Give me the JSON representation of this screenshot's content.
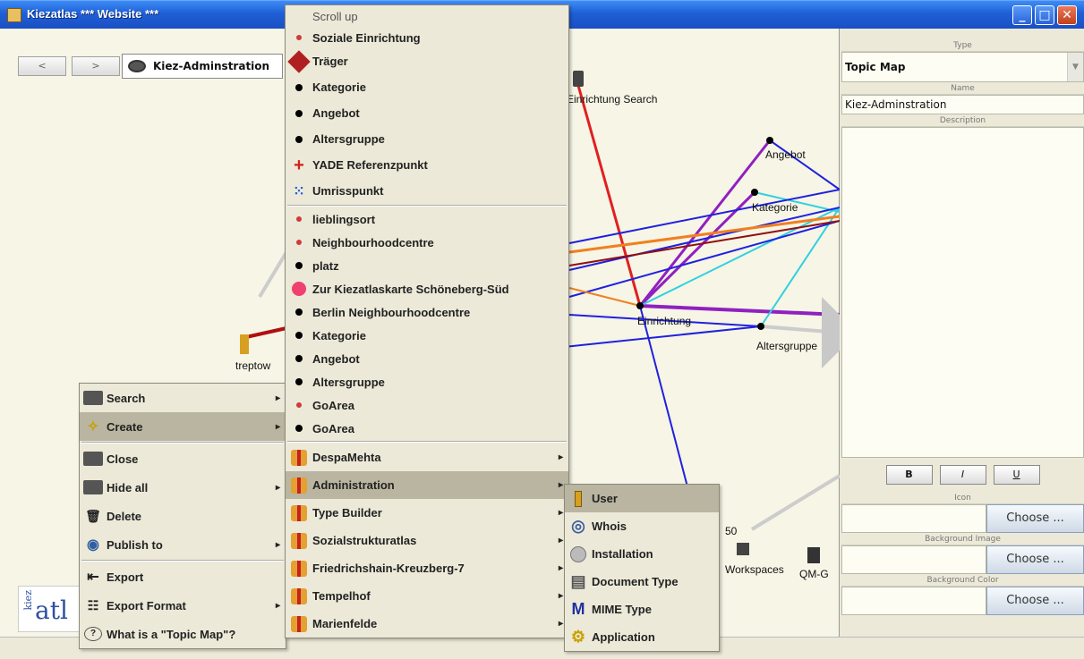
{
  "window": {
    "title": "Kiezatlas *** Website ***"
  },
  "nav": {
    "back": "<",
    "forward": ">",
    "topicmap_label": "Kiez-Adminstration"
  },
  "canvas": {
    "labels": [
      "Einrichtung Search",
      "Angebot",
      "Kategorie",
      "Einrichtung",
      "Altersgruppe",
      "treptow",
      "Workspaces",
      "QM-G",
      "50"
    ]
  },
  "panel": {
    "type_header": "Type",
    "type_value": "Topic Map",
    "name_header": "Name",
    "name_value": "Kiez-Adminstration",
    "description_header": "Description",
    "bold": "B",
    "italic": "I",
    "underline": "U",
    "icon_header": "Icon",
    "bgimage_header": "Background Image",
    "bgcolor_header": "Background Color",
    "choose": "Choose ..."
  },
  "context_menu": [
    {
      "label": "Search",
      "icon": "binoculars-icon",
      "submenu": true
    },
    {
      "label": "Create",
      "icon": "magic-wand-icon",
      "submenu": true,
      "selected": true
    },
    {
      "label": "Close",
      "icon": "close-icon",
      "submenu": false
    },
    {
      "label": "Hide all",
      "icon": "hide-icon",
      "submenu": true
    },
    {
      "label": "Delete",
      "icon": "trash-icon",
      "submenu": false
    },
    {
      "label": "Publish to",
      "icon": "publish-icon",
      "submenu": true
    },
    {
      "label": "Export",
      "icon": "export-icon",
      "submenu": false
    },
    {
      "label": "Export Format",
      "icon": "format-icon",
      "submenu": true
    },
    {
      "label": "What is a \"Topic Map\"?",
      "icon": "help-icon",
      "submenu": false
    }
  ],
  "create_menu": {
    "scroll_up": "Scroll up",
    "types_a": [
      {
        "label": "Soziale Einrichtung",
        "icon": "red-dot-icon"
      },
      {
        "label": "Träger",
        "icon": "diamond-icon"
      },
      {
        "label": "Kategorie",
        "icon": "dot-icon"
      },
      {
        "label": "Angebot",
        "icon": "dot-icon"
      },
      {
        "label": "Altersgruppe",
        "icon": "dot-icon"
      },
      {
        "label": "YADE Referenzpunkt",
        "icon": "crosshair-icon"
      },
      {
        "label": "Umrisspunkt",
        "icon": "blue-points-icon"
      }
    ],
    "types_b": [
      {
        "label": "lieblingsort",
        "icon": "red-dot-icon"
      },
      {
        "label": "Neighbourhoodcentre",
        "icon": "red-dot-icon"
      },
      {
        "label": "platz",
        "icon": "dot-icon"
      },
      {
        "label": "Zur Kiezatlaskarte Schöneberg-Süd",
        "icon": "pink-dot-icon"
      },
      {
        "label": "Berlin Neighbourhoodcentre",
        "icon": "dot-icon"
      },
      {
        "label": "Kategorie",
        "icon": "dot-icon"
      },
      {
        "label": "Angebot",
        "icon": "dot-icon"
      },
      {
        "label": "Altersgruppe",
        "icon": "dot-icon"
      },
      {
        "label": "GoArea",
        "icon": "red-dot-icon"
      },
      {
        "label": "GoArea",
        "icon": "dot-icon"
      }
    ],
    "groups": [
      {
        "label": "DespaMehta",
        "selected": false
      },
      {
        "label": "Administration",
        "selected": true
      },
      {
        "label": "Type Builder",
        "selected": false
      },
      {
        "label": "Sozialstrukturatlas",
        "selected": false
      },
      {
        "label": "Friedrichshain-Kreuzberg-7",
        "selected": false
      },
      {
        "label": "Tempelhof",
        "selected": false
      },
      {
        "label": "Marienfelde",
        "selected": false
      }
    ]
  },
  "admin_menu": [
    {
      "label": "User",
      "icon": "user-icon",
      "selected": true
    },
    {
      "label": "Whois",
      "icon": "globe-icon"
    },
    {
      "label": "Installation",
      "icon": "cd-icon"
    },
    {
      "label": "Document Type",
      "icon": "document-icon"
    },
    {
      "label": "MIME Type",
      "icon": "mime-icon"
    },
    {
      "label": "Application",
      "icon": "gear-icon"
    }
  ]
}
